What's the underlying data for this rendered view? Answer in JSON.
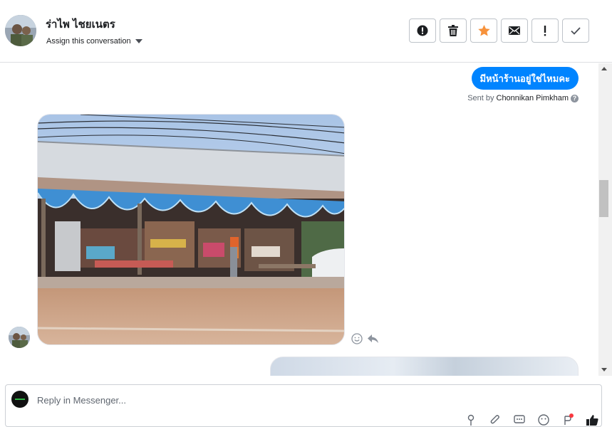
{
  "header": {
    "contact_name": "ร่าไพ ไชยเนตร",
    "assign_label": "Assign this conversation",
    "actions": [
      {
        "icon": "alert-circle-icon",
        "glyph": "!"
      },
      {
        "icon": "trash-icon"
      },
      {
        "icon": "star-icon",
        "color": "#f7923b"
      },
      {
        "icon": "envelope-icon"
      },
      {
        "icon": "exclamation-icon",
        "glyph": "!"
      },
      {
        "icon": "checkmark-icon"
      }
    ]
  },
  "thread": {
    "outgoing_message": "มีหน้าร้านอยู่ใช่ไหมคะ",
    "sent_by_prefix": "Sent by",
    "sent_by_name": "Chonnikan Pimkham",
    "help_glyph": "?",
    "accent_color": "#0084ff"
  },
  "composer": {
    "placeholder": "Reply in Messenger..."
  }
}
